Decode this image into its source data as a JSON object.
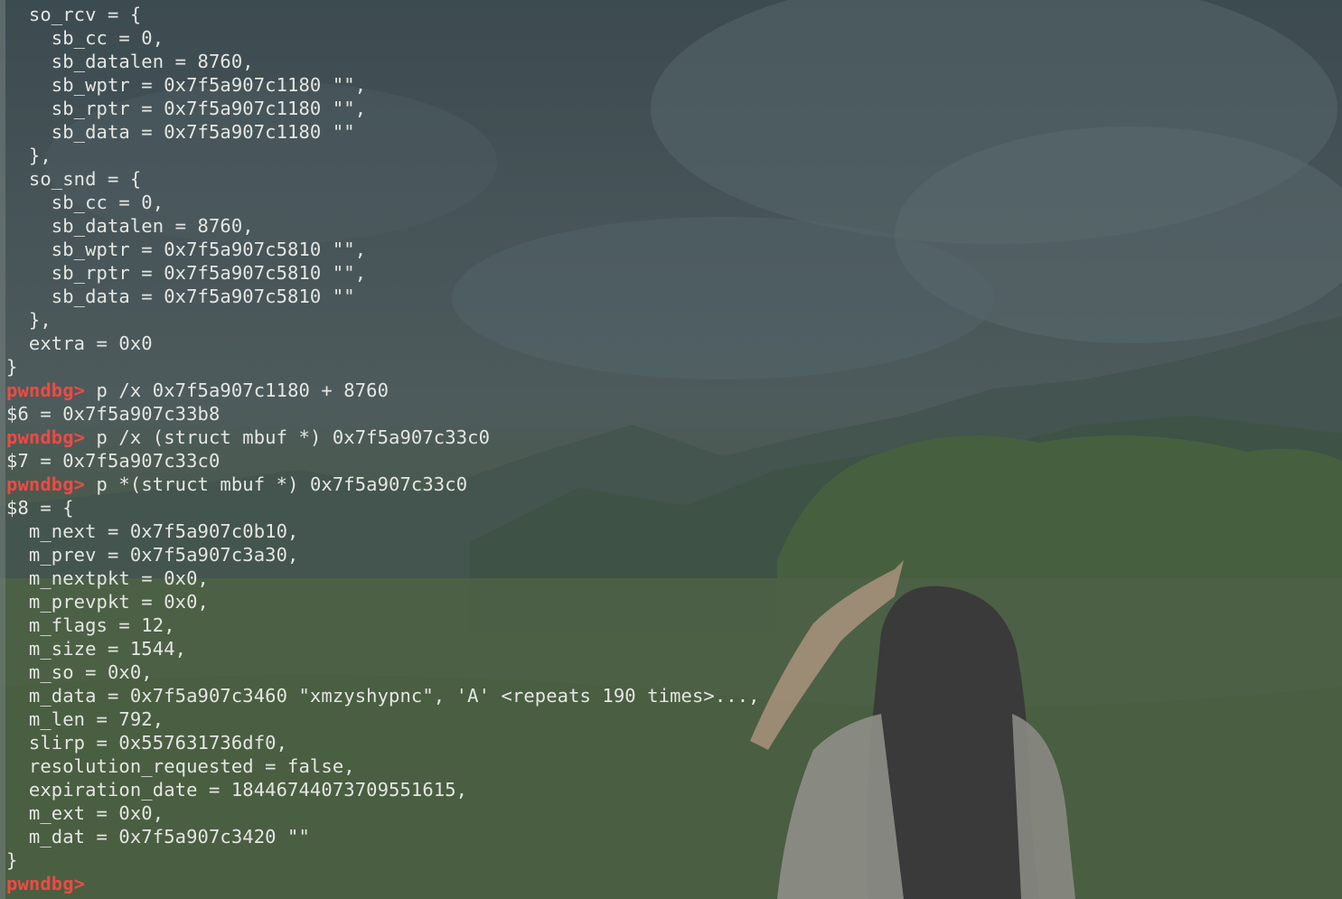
{
  "colors": {
    "text": "#e4e6e2",
    "prompt": "#ef4a43"
  },
  "prompt": "pwndbg>",
  "lines": [
    {
      "text": "  so_rcv = {"
    },
    {
      "text": "    sb_cc = 0,"
    },
    {
      "text": "    sb_datalen = 8760,"
    },
    {
      "text": "    sb_wptr = 0x7f5a907c1180 \"\","
    },
    {
      "text": "    sb_rptr = 0x7f5a907c1180 \"\","
    },
    {
      "text": "    sb_data = 0x7f5a907c1180 \"\""
    },
    {
      "text": "  },"
    },
    {
      "text": "  so_snd = {"
    },
    {
      "text": "    sb_cc = 0,"
    },
    {
      "text": "    sb_datalen = 8760,"
    },
    {
      "text": "    sb_wptr = 0x7f5a907c5810 \"\","
    },
    {
      "text": "    sb_rptr = 0x7f5a907c5810 \"\","
    },
    {
      "text": "    sb_data = 0x7f5a907c5810 \"\""
    },
    {
      "text": "  },"
    },
    {
      "text": "  extra = 0x0"
    },
    {
      "text": "}"
    },
    {
      "text": " p /x 0x7f5a907c1180 + 8760",
      "prompt": true
    },
    {
      "text": "$6 = 0x7f5a907c33b8"
    },
    {
      "text": " p /x (struct mbuf *) 0x7f5a907c33c0",
      "prompt": true
    },
    {
      "text": "$7 = 0x7f5a907c33c0"
    },
    {
      "text": " p *(struct mbuf *) 0x7f5a907c33c0",
      "prompt": true
    },
    {
      "text": "$8 = {"
    },
    {
      "text": "  m_next = 0x7f5a907c0b10,"
    },
    {
      "text": "  m_prev = 0x7f5a907c3a30,"
    },
    {
      "text": "  m_nextpkt = 0x0,"
    },
    {
      "text": "  m_prevpkt = 0x0,"
    },
    {
      "text": "  m_flags = 12,"
    },
    {
      "text": "  m_size = 1544,"
    },
    {
      "text": "  m_so = 0x0,"
    },
    {
      "text": "  m_data = 0x7f5a907c3460 \"xmzyshypnc\", 'A' <repeats 190 times>...,"
    },
    {
      "text": "  m_len = 792,"
    },
    {
      "text": "  slirp = 0x557631736df0,"
    },
    {
      "text": "  resolution_requested = false,"
    },
    {
      "text": "  expiration_date = 18446744073709551615,"
    },
    {
      "text": "  m_ext = 0x0,"
    },
    {
      "text": "  m_dat = 0x7f5a907c3420 \"\""
    },
    {
      "text": "}"
    },
    {
      "text": "",
      "prompt": true
    }
  ]
}
